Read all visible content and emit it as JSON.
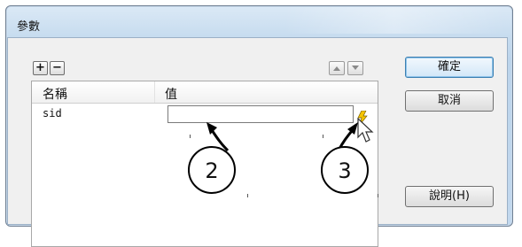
{
  "window": {
    "title": "參數"
  },
  "toolbar": {
    "add_label": "+",
    "remove_label": "−"
  },
  "table": {
    "columns": [
      "名稱",
      "值"
    ],
    "rows": [
      {
        "name": "sid",
        "value": ""
      }
    ]
  },
  "buttons": {
    "ok": "確定",
    "cancel": "取消",
    "help": "說明(H)"
  },
  "callouts": [
    "2",
    "3"
  ]
}
